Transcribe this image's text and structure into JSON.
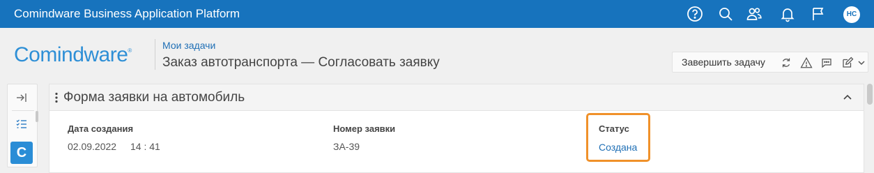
{
  "app": {
    "title": "Comindware Business Application Platform",
    "user_initials": "НС"
  },
  "topbar_icons": [
    "help-icon",
    "search-icon",
    "users-icon",
    "bell-icon",
    "flag-icon"
  ],
  "logo": {
    "text": "Comindware",
    "mark": "®"
  },
  "breadcrumb": {
    "parent": "Мои задачи"
  },
  "page": {
    "title": "Заказ автотранспорта — Согласовать заявку"
  },
  "actions": {
    "finish_label": "Завершить задачу",
    "icons": [
      "refresh-icon",
      "warning-icon",
      "comment-icon",
      "edit-icon",
      "chevron-down-icon"
    ]
  },
  "left_toolbar": {
    "app_letter": "C",
    "icons": [
      "collapse-panel-icon",
      "task-list-icon"
    ]
  },
  "form": {
    "title": "Форма заявки на автомобиль",
    "fields": {
      "created_label": "Дата создания",
      "created_date": "02.09.2022",
      "created_time": "14 : 41",
      "number_label": "Номер заявки",
      "number_value": "ЗА-39",
      "status_label": "Статус",
      "status_value": "Создана"
    }
  },
  "colors": {
    "topbar": "#1773bd",
    "link": "#1f6fb5",
    "highlight": "#f0912a",
    "logo": "#2e8fd6"
  }
}
